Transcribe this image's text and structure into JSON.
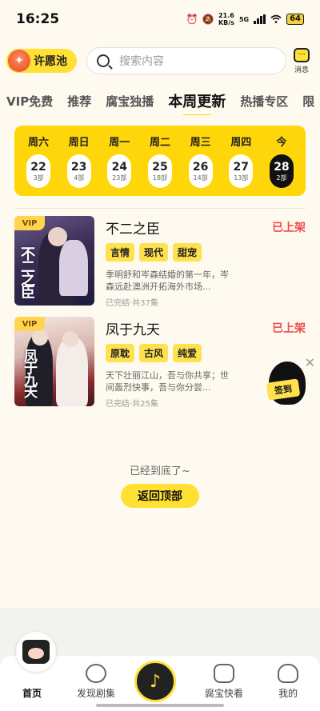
{
  "status_bar": {
    "time": "16:25",
    "net_speed_value": "21.6",
    "net_speed_unit": "KB/s",
    "network": "5G",
    "battery": "64"
  },
  "header": {
    "wish_label": "许愿池",
    "search_placeholder": "搜索内容",
    "message_label": "消息"
  },
  "tabs": [
    {
      "label": "VIP免费",
      "active": false
    },
    {
      "label": "推荐",
      "active": false
    },
    {
      "label": "腐宝独播",
      "active": false
    },
    {
      "label": "本周更新",
      "active": true
    },
    {
      "label": "热播专区",
      "active": false
    },
    {
      "label": "限",
      "active": false
    }
  ],
  "week": [
    {
      "name": "周六",
      "date": "22",
      "count": "3部"
    },
    {
      "name": "周日",
      "date": "23",
      "count": "4部"
    },
    {
      "name": "周一",
      "date": "24",
      "count": "23部"
    },
    {
      "name": "周二",
      "date": "25",
      "count": "18部"
    },
    {
      "name": "周三",
      "date": "26",
      "count": "14部"
    },
    {
      "name": "周四",
      "date": "27",
      "count": "13部"
    },
    {
      "name": "今",
      "date": "28",
      "count": "2部",
      "today": true
    }
  ],
  "items": [
    {
      "vip": "VIP",
      "cover_text": "不二之臣",
      "title": "不二之臣",
      "status": "已上架",
      "tags": [
        "言情",
        "现代",
        "甜宠"
      ],
      "desc": "季明舒和岑森结婚的第一年，岑森远赴澳洲开拓海外市场...",
      "meta": "已完结·共37集"
    },
    {
      "vip": "VIP",
      "cover_text": "凤于九天",
      "title": "凤于九天",
      "status": "已上架",
      "tags": [
        "原耽",
        "古风",
        "纯爱"
      ],
      "desc": "天下壮丽江山，吾与你共享；世间轰烈快事，吾与你分尝...",
      "meta": "已完结·共25集"
    }
  ],
  "float": {
    "label": "签到",
    "close": "✕"
  },
  "footer": {
    "end_text": "已经到底了~",
    "back_top": "返回顶部"
  },
  "nav": [
    {
      "label": "首页",
      "icon": "home-icon",
      "active": true
    },
    {
      "label": "发现剧集",
      "icon": "planet-icon",
      "active": false
    },
    {
      "label": "",
      "icon": "music-disc-icon",
      "active": false
    },
    {
      "label": "腐宝快看",
      "icon": "video-camera-icon",
      "active": false
    },
    {
      "label": "我的",
      "icon": "mascot-icon",
      "active": false
    }
  ],
  "colors": {
    "accent": "#ffe033",
    "status_red": "#f04c4c",
    "today_bg": "#111111"
  }
}
